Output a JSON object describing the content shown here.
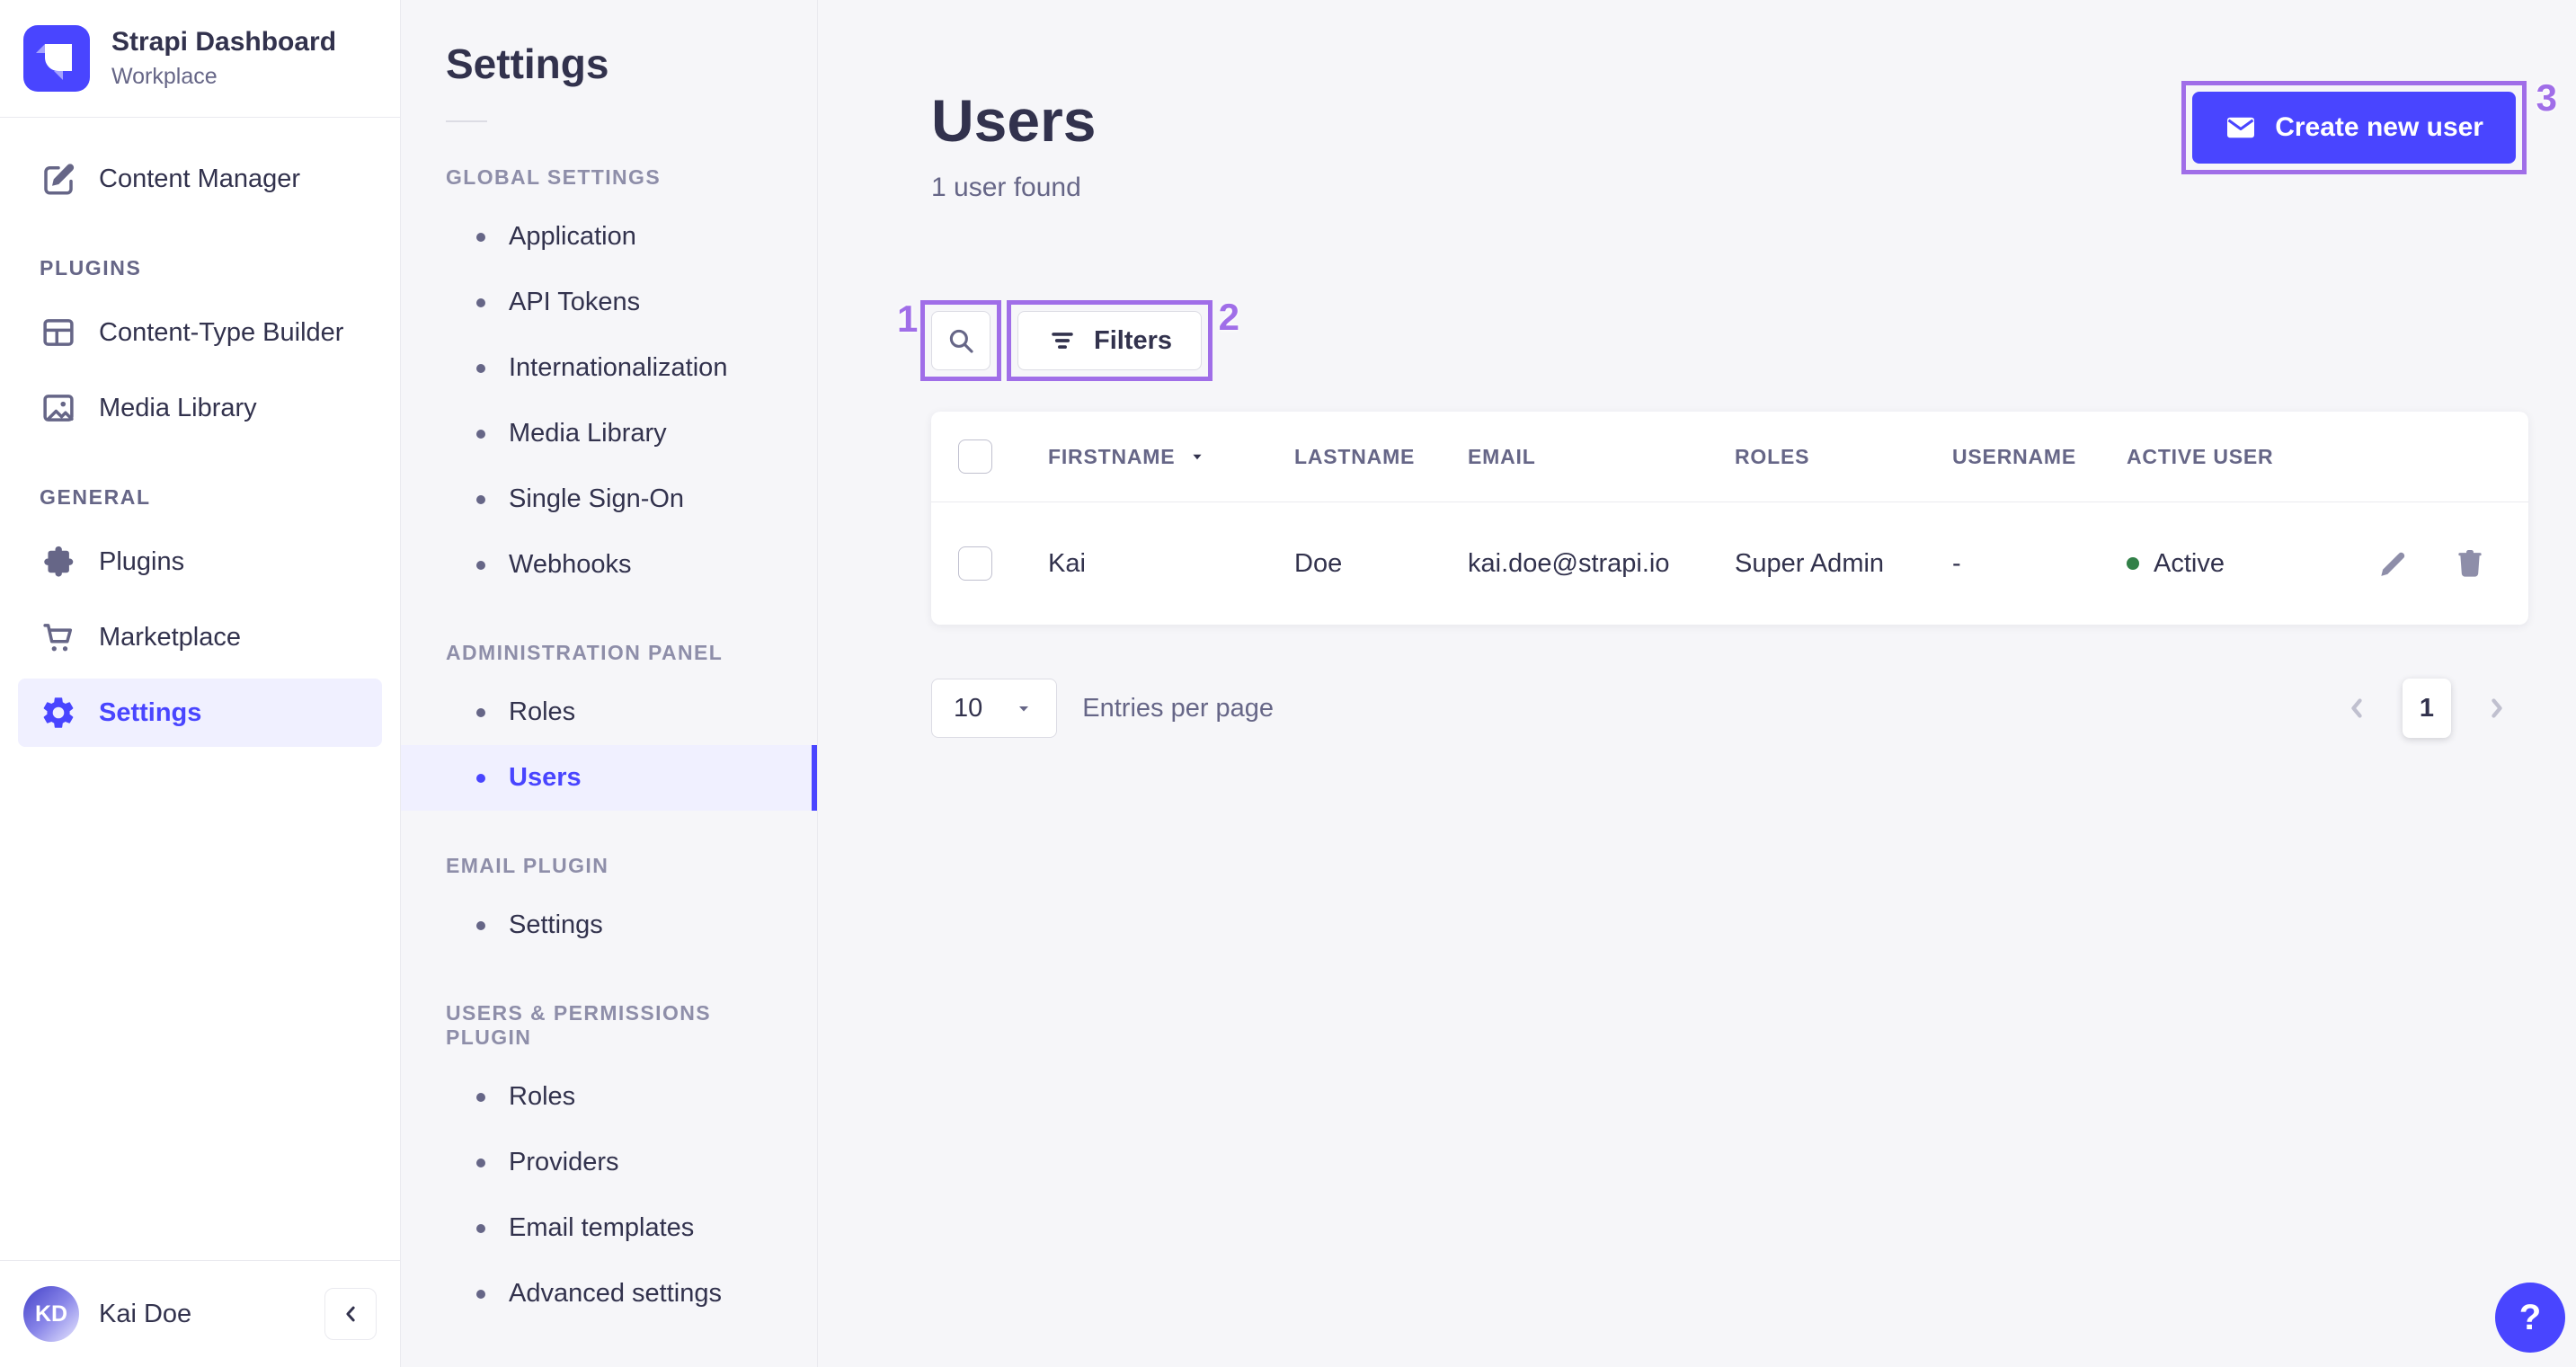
{
  "colors": {
    "accent": "#4945ff",
    "annotation": "#a06ee8",
    "success": "#328048"
  },
  "app": {
    "name": "Strapi Dashboard",
    "workspace": "Workplace"
  },
  "main_nav": {
    "content_manager": "Content Manager",
    "sections": [
      {
        "label": "PLUGINS",
        "items": [
          "Content-Type Builder",
          "Media Library"
        ]
      },
      {
        "label": "GENERAL",
        "items": [
          "Plugins",
          "Marketplace",
          "Settings"
        ]
      }
    ],
    "user": {
      "initials": "KD",
      "name": "Kai Doe"
    }
  },
  "settings_nav": {
    "title": "Settings",
    "sections": [
      {
        "label": "GLOBAL SETTINGS",
        "items": [
          "Application",
          "API Tokens",
          "Internationalization",
          "Media Library",
          "Single Sign-On",
          "Webhooks"
        ]
      },
      {
        "label": "ADMINISTRATION PANEL",
        "items": [
          "Roles",
          "Users"
        ]
      },
      {
        "label": "EMAIL PLUGIN",
        "items": [
          "Settings"
        ]
      },
      {
        "label": "USERS & PERMISSIONS PLUGIN",
        "items": [
          "Roles",
          "Providers",
          "Email templates",
          "Advanced settings"
        ]
      }
    ]
  },
  "content": {
    "title": "Users",
    "subtitle": "1 user found",
    "create_button_label": "Create new user",
    "filters_label": "Filters",
    "table": {
      "headers": [
        "FIRSTNAME",
        "LASTNAME",
        "EMAIL",
        "ROLES",
        "USERNAME",
        "ACTIVE USER"
      ],
      "rows": [
        {
          "firstname": "Kai",
          "lastname": "Doe",
          "email": "kai.doe@strapi.io",
          "roles": "Super Admin",
          "username": "-",
          "active_label": "Active"
        }
      ]
    },
    "pagination": {
      "page_size": "10",
      "label": "Entries per page",
      "current_page": "1"
    }
  },
  "annotations": {
    "one": "1",
    "two": "2",
    "three": "3"
  },
  "help": {
    "label": "?"
  }
}
